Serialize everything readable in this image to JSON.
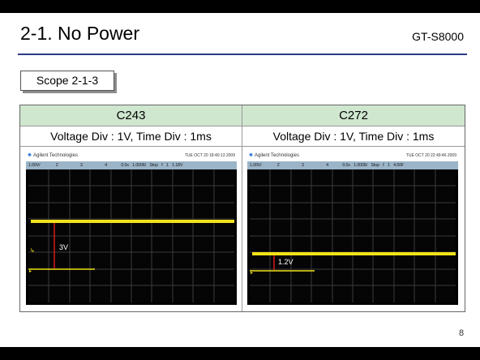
{
  "slide": {
    "title": "2-1. No Power",
    "model": "GT-S8000",
    "scope_label": "Scope 2-1-3",
    "page_number": "8"
  },
  "table": {
    "columns": [
      {
        "header": "C243",
        "settings": "Voltage Div : 1V, Time Div : 1ms",
        "scope": {
          "brand": "Agilent Technologies",
          "timestamp": "TUE OCT 20 18:40:13 2009",
          "status_fields": [
            "1.00V/",
            "2",
            "3",
            "4",
            "0.0s",
            "1.000ß/",
            "Stop",
            "f",
            "1",
            "1.18V"
          ],
          "annotation": "3V",
          "trace_color": "#f2e21a",
          "marker_color": "#d61a1a"
        }
      },
      {
        "header": "C272",
        "settings": "Voltage Div : 1V, Time Div : 1ms",
        "scope": {
          "brand": "Agilent Technologies",
          "timestamp": "TUE OCT 20 22:49:46 2009",
          "status_fields": [
            "1.00V/",
            "2",
            "3",
            "4",
            "0.0s",
            "1.000ß/",
            "Stop",
            "f",
            "1",
            "4.50F"
          ],
          "annotation": "1.2V",
          "trace_color": "#f2e21a",
          "marker_color": "#d61a1a"
        }
      }
    ]
  },
  "colors": {
    "header_fill": "#cfe6cf",
    "title_rule": "#2b3a88"
  }
}
